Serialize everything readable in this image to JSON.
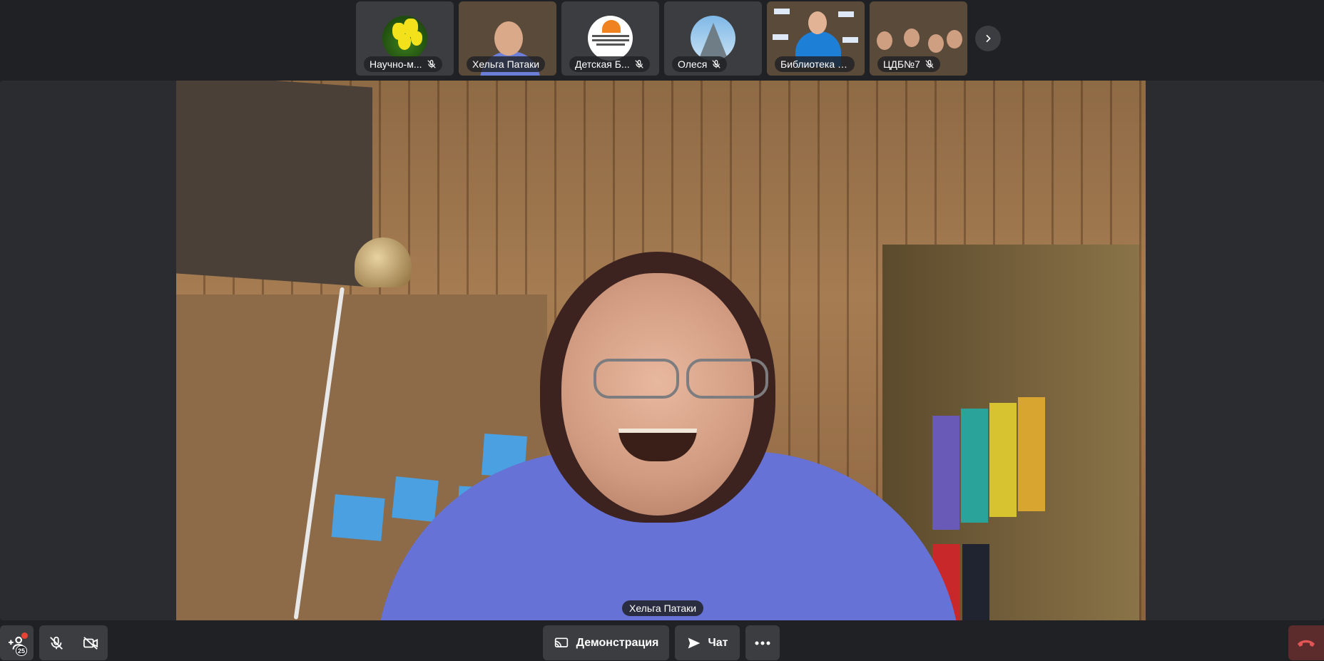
{
  "participants": [
    {
      "name": "Научно-м...",
      "muted": true
    },
    {
      "name": "Хельга Патаки",
      "muted": false
    },
    {
      "name": "Детская Б...",
      "muted": true
    },
    {
      "name": "Олеся",
      "muted": true
    },
    {
      "name": "Библиотека и...",
      "muted": false
    },
    {
      "name": "ЦДБ№7",
      "muted": true
    }
  ],
  "main": {
    "speaker_name": "Хельга Патаки"
  },
  "toolbar": {
    "invite_count": "25",
    "screen_share_label": "Демонстрация",
    "chat_label": "Чат"
  },
  "colors": {
    "background": "#202124",
    "tile": "#3c3d40",
    "hangup": "#5c2b2b",
    "notification": "#ea4335"
  },
  "icons": {
    "next": "chevron-right-icon",
    "invite": "add-user-icon",
    "mic": "microphone-off-icon",
    "camera": "camera-off-icon",
    "screen_share": "screen-share-icon",
    "chat": "send-icon",
    "more": "more-horizontal-icon",
    "hangup": "phone-hangup-icon"
  }
}
